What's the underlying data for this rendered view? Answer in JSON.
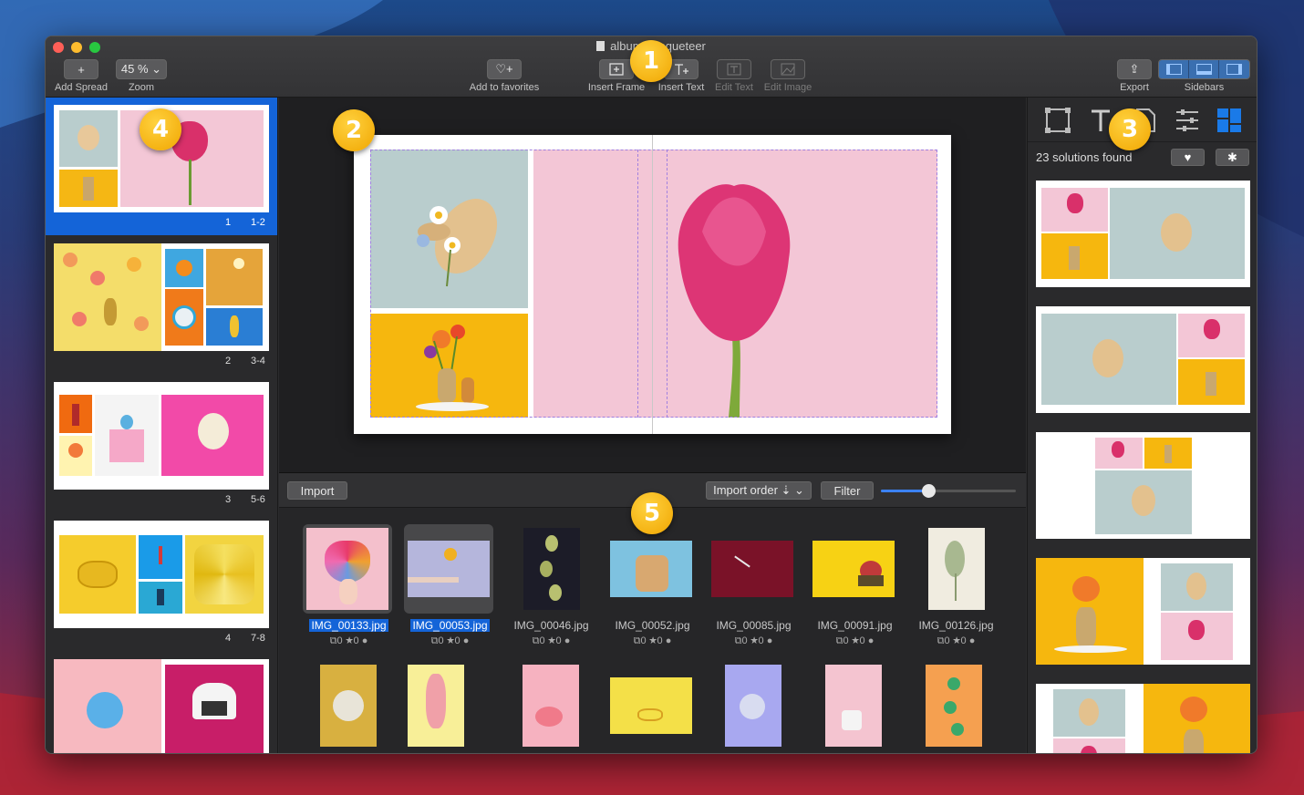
{
  "window": {
    "title": "album - coqueteer"
  },
  "toolbar": {
    "add_spread": {
      "icon": "+",
      "label": "Add Spread"
    },
    "zoom": {
      "value": "45 % ⌄",
      "label": "Zoom"
    },
    "favorites": {
      "icon": "♡+",
      "label": "Add to favorites"
    },
    "insert_frame": {
      "label": "Insert Frame"
    },
    "insert_text": {
      "label": "Insert Text"
    },
    "edit_text": {
      "label": "Edit Text"
    },
    "edit_image": {
      "label": "Edit Image"
    },
    "export": {
      "icon": "⇪",
      "label": "Export"
    },
    "sidebars": {
      "label": "Sidebars"
    }
  },
  "spreads": [
    {
      "index": "1",
      "pages": "1-2",
      "selected": true
    },
    {
      "index": "2",
      "pages": "3-4"
    },
    {
      "index": "3",
      "pages": "5-6"
    },
    {
      "index": "4",
      "pages": "7-8"
    },
    {
      "index": "",
      "pages": ""
    }
  ],
  "browser": {
    "import_label": "Import",
    "sort_label": "Import order ⇣ ⌄",
    "filter_label": "Filter",
    "thumb_size": 0.35,
    "images_row1": [
      {
        "name": "IMG_00133.jpg",
        "meta": "⧉0 ★0 ●",
        "selected": true
      },
      {
        "name": "IMG_00053.jpg",
        "meta": "⧉0 ★0 ●",
        "selected": true
      },
      {
        "name": "IMG_00046.jpg",
        "meta": "⧉0 ★0 ●"
      },
      {
        "name": "IMG_00052.jpg",
        "meta": "⧉0 ★0 ●"
      },
      {
        "name": "IMG_00085.jpg",
        "meta": "⧉0 ★0 ●"
      },
      {
        "name": "IMG_00091.jpg",
        "meta": "⧉0 ★0 ●"
      },
      {
        "name": "IMG_00126.jpg",
        "meta": "⧉0 ★0 ●"
      }
    ]
  },
  "right_panel": {
    "solutions_text": "23 solutions found",
    "heart_icon": "♥",
    "gear_icon": "✱"
  },
  "badges": {
    "b1": "1",
    "b2": "2",
    "b3": "3",
    "b4": "4",
    "b5": "5"
  },
  "colors": {
    "accent": "#1464d8",
    "badge": "#f5b20a",
    "pink": "#f2c4d4",
    "yellow": "#f7c21a",
    "sage": "#b8cccc"
  }
}
